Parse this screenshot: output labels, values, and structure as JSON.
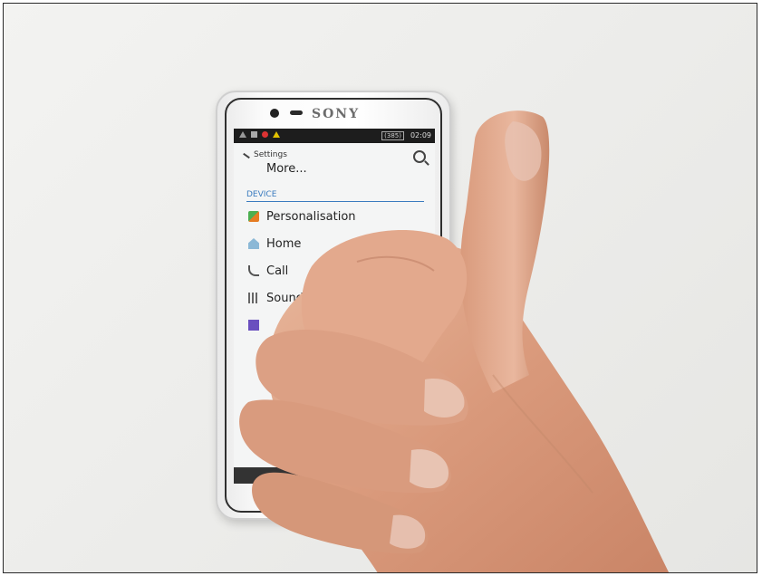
{
  "phone": {
    "brand": "SONY",
    "status_bar": {
      "battery": "(385)",
      "time": "02:09"
    },
    "app_bar": {
      "title": "Settings",
      "subtitle": "More..."
    },
    "section_header": "DEVICE",
    "items": [
      {
        "label": "Personalisation",
        "icon": "personalisation-icon"
      },
      {
        "label": "Home",
        "icon": "home-icon"
      },
      {
        "label": "Call",
        "icon": "call-icon"
      },
      {
        "label": "Sound",
        "icon": "sound-icon"
      }
    ]
  },
  "colors": {
    "accent": "#3a7bbf",
    "skin": "#e2a88c",
    "background": "#efefed"
  }
}
